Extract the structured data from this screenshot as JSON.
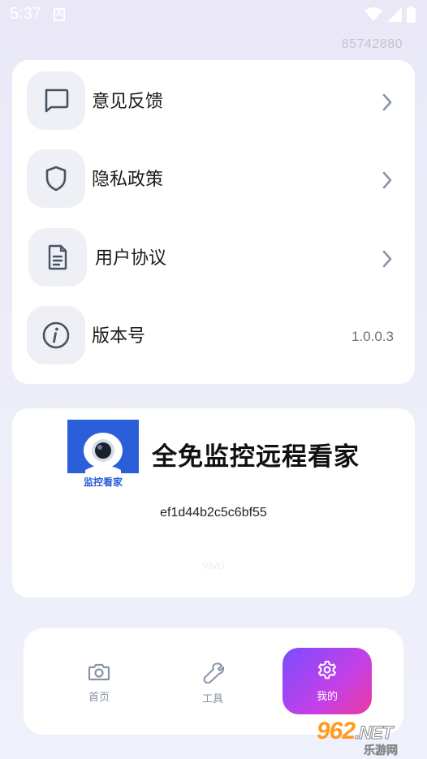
{
  "status_bar": {
    "time": "5:37",
    "notification_glyph": "A",
    "icons": [
      "wifi-icon",
      "signal-icon",
      "battery-icon"
    ]
  },
  "header": {
    "user_id": "85742880"
  },
  "menu": {
    "items": [
      {
        "label": "意见反馈",
        "icon": "chat-bubble-icon",
        "trailing": "chevron-right-icon"
      },
      {
        "label": "隐私政策",
        "icon": "shield-icon",
        "trailing": "chevron-right-icon"
      },
      {
        "label": "用户协议",
        "icon": "document-icon",
        "trailing": "chevron-right-icon"
      },
      {
        "label": "版本号",
        "icon": "info-icon",
        "value": "1.0.0.3"
      }
    ]
  },
  "app_info": {
    "logo_caption": "监控看家",
    "name": "全免监控远程看家",
    "hash": "ef1d44b2c5c6bf55",
    "brand": "vivo"
  },
  "bottom_nav": {
    "items": [
      {
        "label": "首页",
        "icon": "camera-icon",
        "active": false
      },
      {
        "label": "工具",
        "icon": "wrench-icon",
        "active": false
      },
      {
        "label": "我的",
        "icon": "gear-icon",
        "active": true
      }
    ]
  },
  "watermark": {
    "top": "962",
    "suffix": ".NET",
    "bottom": "乐游网"
  },
  "colors": {
    "accent_gradient_start": "#7b4dff",
    "accent_gradient_end": "#e93b9f",
    "logo_blue": "#2b5fd9",
    "icon_stroke": "#4a5363",
    "chevron": "#8a94a6"
  }
}
